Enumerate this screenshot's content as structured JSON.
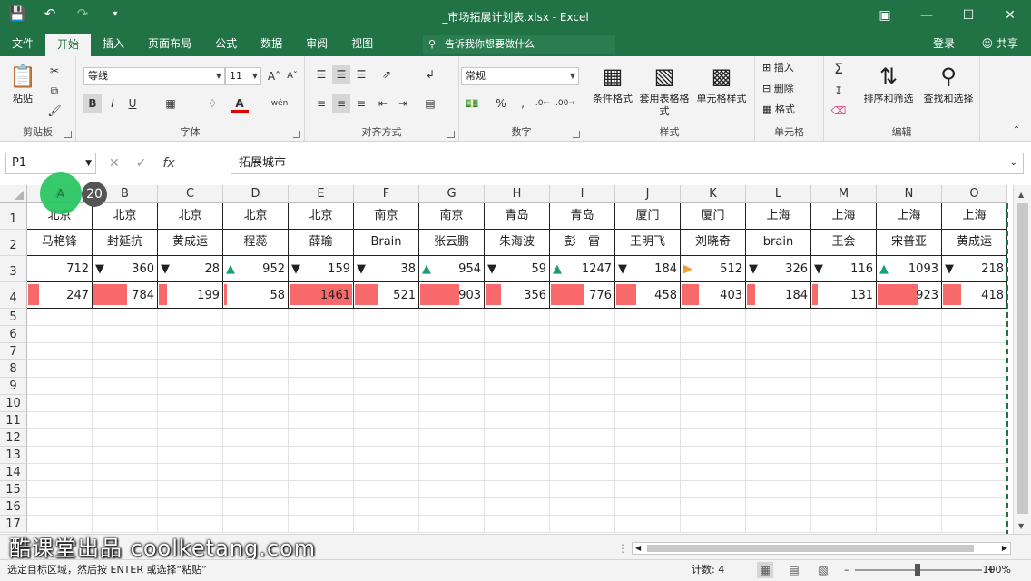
{
  "window": {
    "title": "_市场拓展计划表.xlsx - Excel"
  },
  "tabs": [
    "文件",
    "开始",
    "插入",
    "页面布局",
    "公式",
    "数据",
    "审阅",
    "视图"
  ],
  "active_tab": "开始",
  "tellme": "告诉我你想要做什么",
  "login": "登录",
  "share": "共享",
  "ribbon": {
    "clipboard": {
      "label": "剪贴板",
      "paste": "粘贴"
    },
    "font": {
      "label": "字体",
      "name": "等线",
      "size": "11",
      "bold": "B",
      "italic": "I",
      "underline": "U"
    },
    "alignment": {
      "label": "对齐方式"
    },
    "number": {
      "label": "数字",
      "format": "常规"
    },
    "styles": {
      "label": "样式",
      "cond_format": "条件格式",
      "table_format": "套用表格格式",
      "cell_styles": "单元格样式"
    },
    "cells": {
      "label": "单元格",
      "insert": "插入",
      "delete": "删除",
      "format": "格式"
    },
    "editing": {
      "label": "编辑",
      "sort_filter": "排序和筛选",
      "find_select": "查找和选择"
    }
  },
  "formula_bar": {
    "name_box": "P1",
    "value": "拓展城市"
  },
  "columns": [
    "A",
    "B",
    "C",
    "D",
    "E",
    "F",
    "G",
    "H",
    "I",
    "J",
    "K",
    "L",
    "M",
    "N",
    "O"
  ],
  "rows": [
    "1",
    "2",
    "3",
    "4",
    "5",
    "6",
    "7",
    "8",
    "9",
    "10",
    "11",
    "12",
    "13",
    "14",
    "15",
    "16",
    "17"
  ],
  "sheet": {
    "cities": [
      "北京",
      "北京",
      "北京",
      "北京",
      "北京",
      "南京",
      "南京",
      "青岛",
      "青岛",
      "厦门",
      "厦门",
      "上海",
      "上海",
      "上海",
      "上海"
    ],
    "names": [
      "马艳锋",
      "封延抗",
      "黄成运",
      "程蕊",
      "薛瑜",
      "Brain",
      "张云鹏",
      "朱海波",
      "彭　雷",
      "王明飞",
      "刘晓奇",
      "brain",
      "王会",
      "宋普亚",
      "黄成运"
    ],
    "row3": [
      712,
      360,
      28,
      952,
      159,
      38,
      954,
      59,
      1247,
      184,
      512,
      326,
      116,
      1093,
      218
    ],
    "row3_icons": [
      "none",
      "down",
      "down",
      "up",
      "down",
      "down",
      "up",
      "down",
      "up",
      "down",
      "side",
      "down",
      "down",
      "up",
      "down"
    ],
    "row4": [
      247,
      784,
      199,
      58,
      1461,
      521,
      903,
      356,
      776,
      458,
      403,
      184,
      131,
      923,
      418
    ],
    "row4_bar_max": 1461
  },
  "overlay": {
    "selected_col": "A",
    "badge": "20",
    "watermark": "酷课堂出品 coolketang.com"
  },
  "status": {
    "message": "选定目标区域，然后按 ENTER 或选择“粘贴”",
    "count": "计数: 4",
    "zoom": "100%"
  },
  "colors": {
    "excel_green": "#217346",
    "bar": "#f8696b",
    "up": "#1a9e7a",
    "down": "#e55b2c",
    "side": "#f0a030"
  }
}
